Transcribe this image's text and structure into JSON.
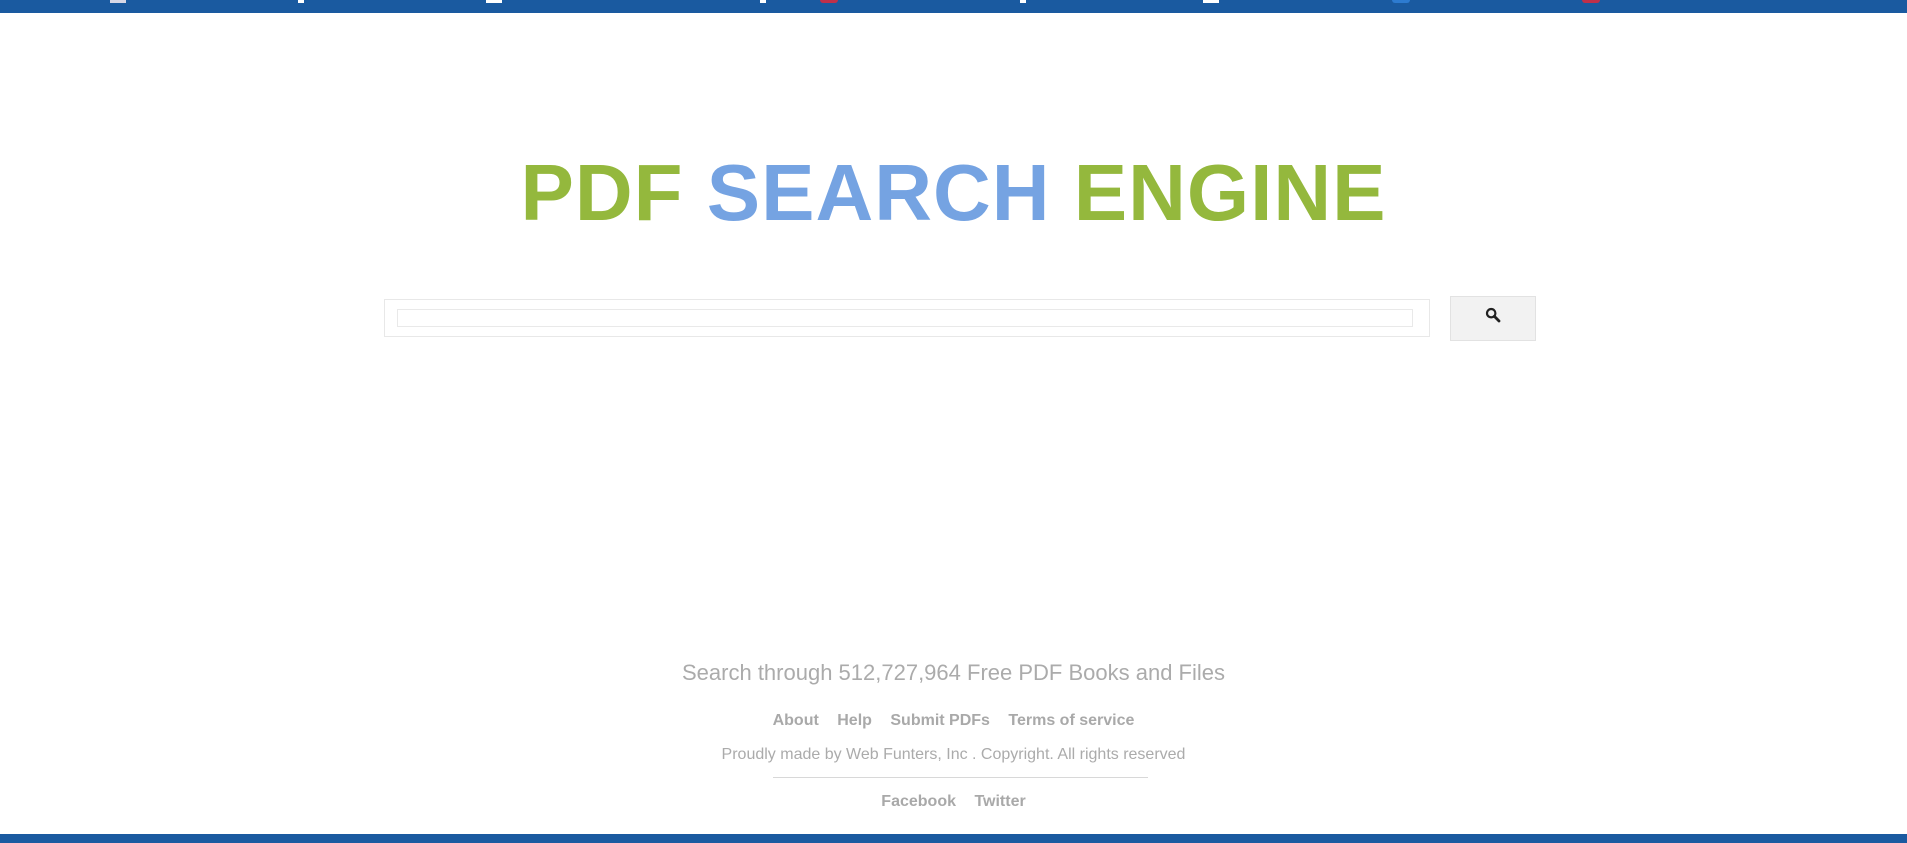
{
  "logo": {
    "part1": "PDF",
    "part2": "SEARCH",
    "part3": "ENGINE"
  },
  "search": {
    "placeholder": "",
    "value": "",
    "button_icon": "search-icon"
  },
  "tagline": "Search through 512,727,964 Free PDF Books and Files",
  "footer": {
    "links": [
      "About",
      "Help",
      "Submit PDFs",
      "Terms of service"
    ],
    "copyright": "Proudly made by Web Funters, Inc . Copyright. All rights reserved",
    "social": [
      "Facebook",
      "Twitter"
    ]
  },
  "colors": {
    "header_bar": "#1a5aa0",
    "logo_green": "#94b83d",
    "logo_blue": "#75a3e2",
    "muted_text": "#ababab"
  }
}
